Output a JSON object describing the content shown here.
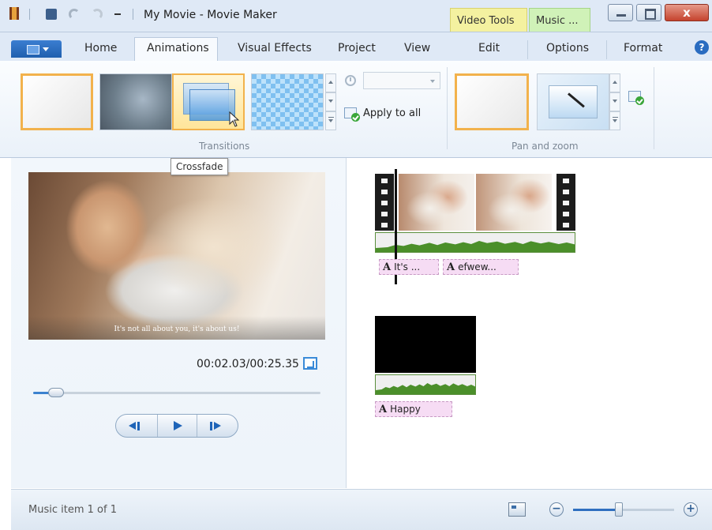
{
  "window": {
    "title": "My Movie - Movie Maker",
    "context_tabs": [
      "Video Tools",
      "Music ..."
    ],
    "controls": {
      "minimize": "minimize",
      "maximize": "maximize",
      "close": "x"
    }
  },
  "tabs": {
    "items": [
      "Home",
      "Animations",
      "Visual Effects",
      "Project",
      "View",
      "Edit",
      "Options",
      "Format"
    ],
    "selected": "Animations",
    "help_glyph": "?"
  },
  "ribbon": {
    "transitions": {
      "group_label": "Transitions",
      "items": [
        "none",
        "blur",
        "crossfade",
        "mosaic"
      ],
      "selected": "crossfade",
      "apply_to_all": "Apply to all",
      "duration_value": ""
    },
    "pan_and_zoom": {
      "group_label": "Pan and zoom",
      "items": [
        "none",
        "automatic"
      ],
      "selected": "none"
    }
  },
  "tooltip": "Crossfade",
  "preview": {
    "caption": "It's not all about you, it's about us!",
    "time": "00:02.03/00:25.35",
    "position_fraction": 0.08
  },
  "storyboard": {
    "captions": [
      "It's ...",
      "efwew...",
      "Happy"
    ],
    "caption_glyph": "A"
  },
  "status": {
    "text": "Music item 1 of 1",
    "zoom_fraction": 0.45,
    "zoom_out": "−",
    "zoom_in": "+"
  },
  "colors": {
    "selection": "#f2b24c",
    "video_tools": "#f4f1a0",
    "music_tools": "#d0f2b8",
    "caption_chip": "#f6dcf4",
    "audio_wave": "#4b8f2a"
  }
}
